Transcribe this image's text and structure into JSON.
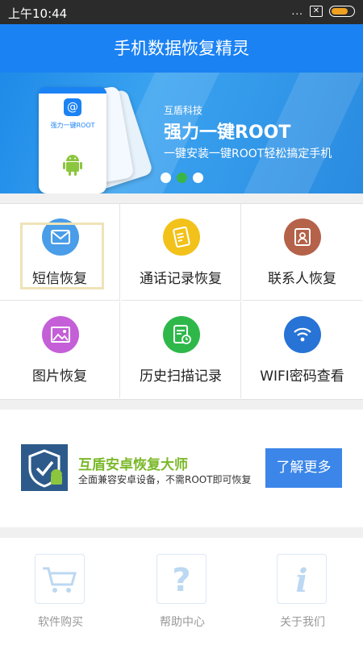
{
  "statusbar": {
    "time": "上午10:44",
    "signal": "..."
  },
  "title": "手机数据恢复精灵",
  "banner": {
    "phone_label": "强力一键ROOT",
    "company": "互盾科技",
    "headline": "强力一键ROOT",
    "subline": "一键安装一键ROOT轻松搞定手机"
  },
  "grid": [
    {
      "label": "短信恢复",
      "icon": "envelope-icon",
      "color": "#4a9de8"
    },
    {
      "label": "通话记录恢复",
      "icon": "call-log-icon",
      "color": "#f2c21a"
    },
    {
      "label": "联系人恢复",
      "icon": "contacts-icon",
      "color": "#b5624a"
    },
    {
      "label": "图片恢复",
      "icon": "image-icon",
      "color": "#c45fd8"
    },
    {
      "label": "历史扫描记录",
      "icon": "history-scan-icon",
      "color": "#2fb84a"
    },
    {
      "label": "WIFI密码查看",
      "icon": "wifi-icon",
      "color": "#2773d6"
    }
  ],
  "promo": {
    "title": "互盾安卓恢复大师",
    "desc": "全面兼容安卓设备，不需ROOT即可恢复",
    "button": "了解更多"
  },
  "bottom": [
    {
      "label": "软件购买",
      "icon": "cart-icon"
    },
    {
      "label": "帮助中心",
      "icon": "question-icon"
    },
    {
      "label": "关于我们",
      "icon": "info-icon"
    }
  ]
}
